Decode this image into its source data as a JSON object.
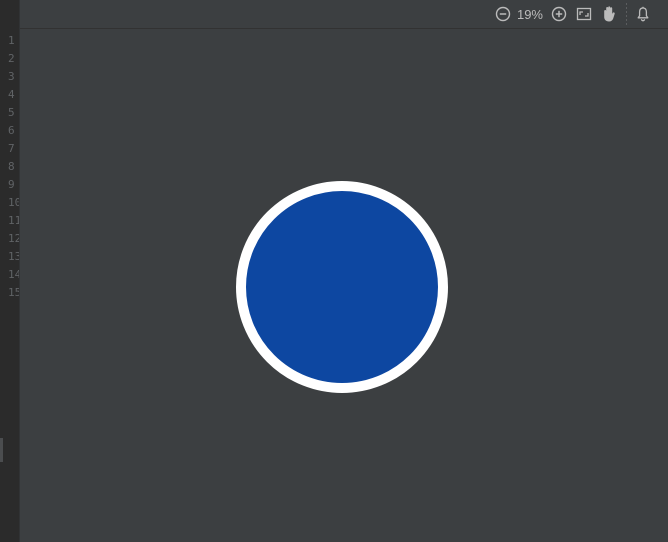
{
  "editor": {
    "line_numbers": [
      "1",
      "2",
      "3",
      "4",
      "5",
      "6",
      "7",
      "8",
      "9",
      "10",
      "11",
      "12",
      "13",
      "14",
      "15"
    ]
  },
  "toolbar": {
    "zoom_level": "19%",
    "icons": [
      "zoom-out-icon",
      "zoom-in-icon",
      "actual-size-icon",
      "hand-icon",
      "notification-bell-icon"
    ]
  },
  "preview": {
    "shape": "circle",
    "fill_color": "#0d47a1",
    "stroke_color": "#ffffff"
  },
  "colors": {
    "background": "#3c3f41",
    "icon": "#bbbbbb"
  }
}
